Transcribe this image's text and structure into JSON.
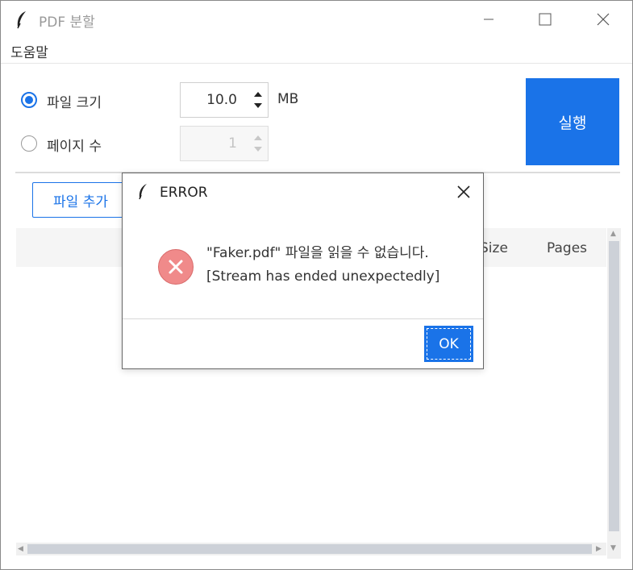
{
  "window": {
    "title": "PDF 분할",
    "menu_help": "도움말"
  },
  "options": {
    "file_size": {
      "label": "파일 크기",
      "value": "10.0",
      "unit": "MB",
      "selected": true
    },
    "page_count": {
      "label": "페이지 수",
      "value": "1",
      "selected": false
    }
  },
  "run_button": "실행",
  "add_file_button": "파일 추가",
  "table": {
    "columns_visible": [
      "Size",
      "Pages"
    ],
    "size_header_partial": "Size",
    "pages_header": "Pages"
  },
  "dialog": {
    "title": "ERROR",
    "message_line1": "\"Faker.pdf\" 파일을 읽을 수 없습니다.",
    "message_line2": "[Stream has ended unexpectedly]",
    "ok_label": "OK"
  },
  "colors": {
    "accent": "#1a73e8",
    "error_icon": "#f08a8a"
  }
}
